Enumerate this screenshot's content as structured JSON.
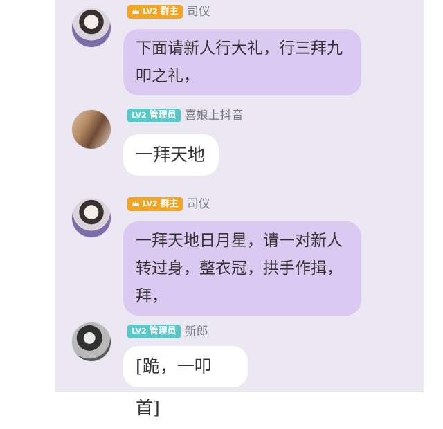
{
  "messages": [
    {
      "badge": {
        "lv": "LV2",
        "role": "群主"
      },
      "sender": "司仪",
      "text": "下面请新人行大礼，行三拜九叩之礼，",
      "bubble": "purple"
    },
    {
      "badge": {
        "lv": "LV2",
        "role": "管理员"
      },
      "sender": "喜娘上抖音",
      "text": "一拜天地",
      "bubble": "white"
    },
    {
      "badge": {
        "lv": "LV2",
        "role": "群主"
      },
      "sender": "司仪",
      "text": "一拜天地日月星，请一对新人转过身，整衣冠，拱手作揖，拜，",
      "bubble": "purple"
    },
    {
      "badge": {
        "lv": "LV2",
        "role": "管理员"
      },
      "sender": "新郎",
      "text": "[跪，一叩首]",
      "bubble": "white"
    }
  ],
  "colors": {
    "panel_background": "#ebe8f3",
    "purple_bubble": "#dcc9f1",
    "white_bubble": "#ffffff",
    "owner_badge": "#f0a623",
    "admin_badge": "#58c7c8"
  },
  "icons": {
    "owner_badge": "crown-icon"
  }
}
